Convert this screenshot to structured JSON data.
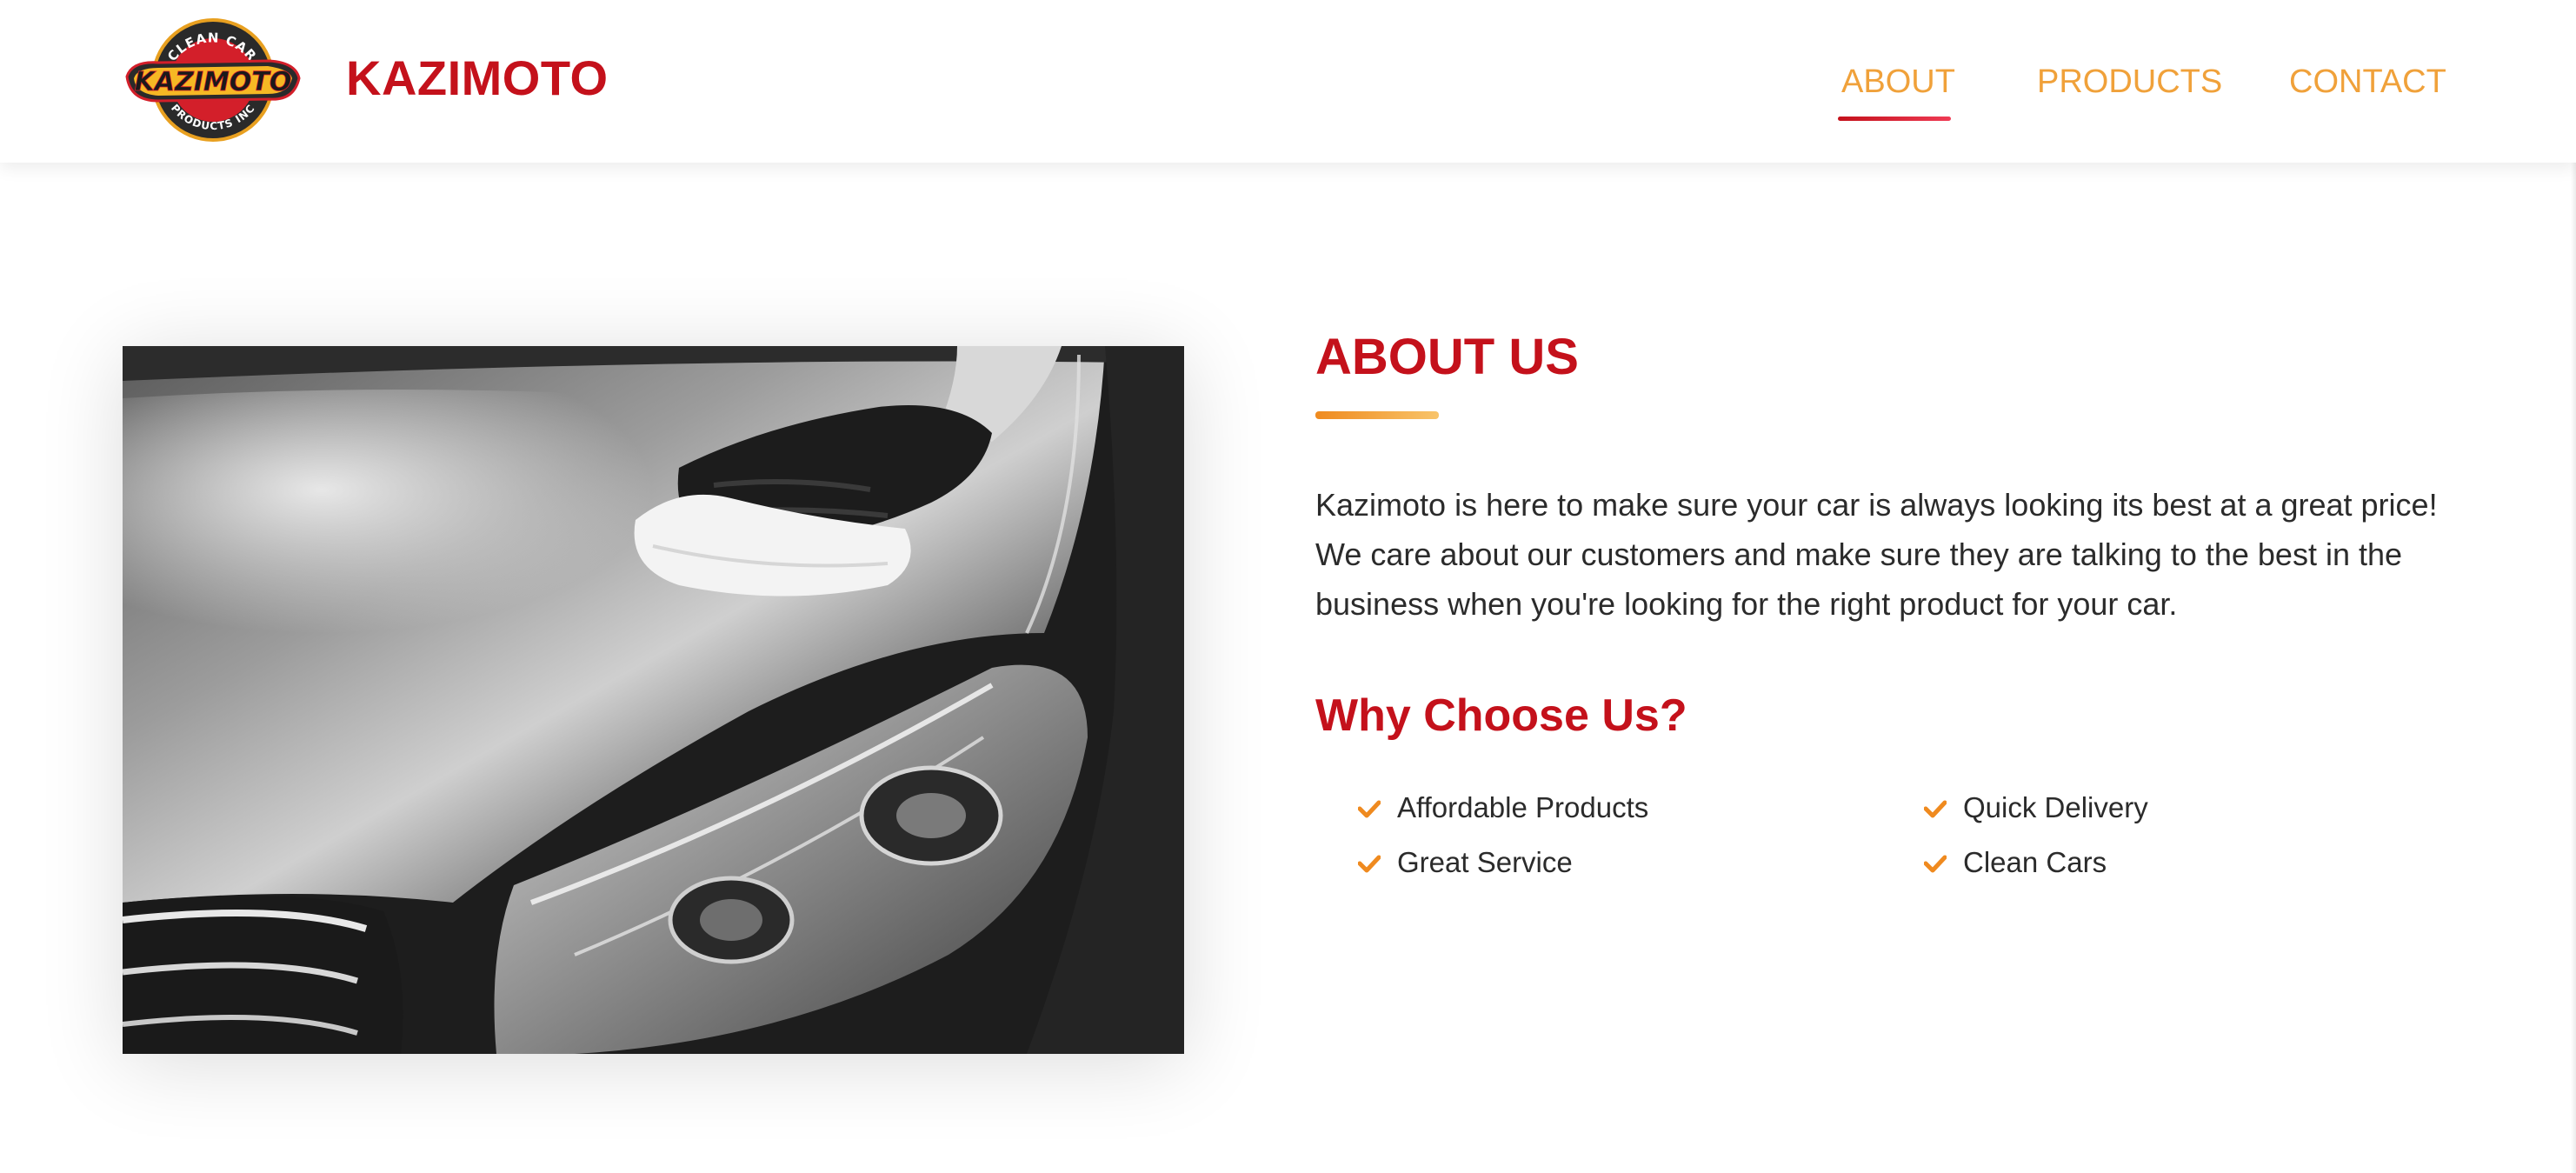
{
  "header": {
    "logo": {
      "alt": "Kazimoto Clean Car Products Inc logo",
      "top_text": "CLEAN CAR",
      "main_text": "KAZIMOTO",
      "bottom_text": "PRODUCTS INC"
    },
    "brand": "KAZIMOTO",
    "nav": [
      {
        "label": "ABOUT",
        "active": true
      },
      {
        "label": "PRODUCTS",
        "active": false
      },
      {
        "label": "CONTACT",
        "active": false
      }
    ]
  },
  "about": {
    "image_alt": "Gloved hand polishing a black car hood with a white cloth",
    "title": "ABOUT US",
    "text": "Kazimoto is here to make sure your car is always looking its best at a great price! We care about our customers and make sure they are talking to the best in the business when you're looking for the right product for your car.",
    "why_title": "Why Choose Us?",
    "features": [
      "Affordable Products",
      "Great Service",
      "Quick Delivery",
      "Clean Cars"
    ]
  },
  "colors": {
    "brand_red": "#c4111b",
    "nav_orange": "#f0a13a",
    "accent_orange": "#ef8a1f",
    "text_dark": "#2b2b2b",
    "check_orange": "#ef8a1f"
  },
  "icons": {
    "feature_check": "check-icon"
  }
}
